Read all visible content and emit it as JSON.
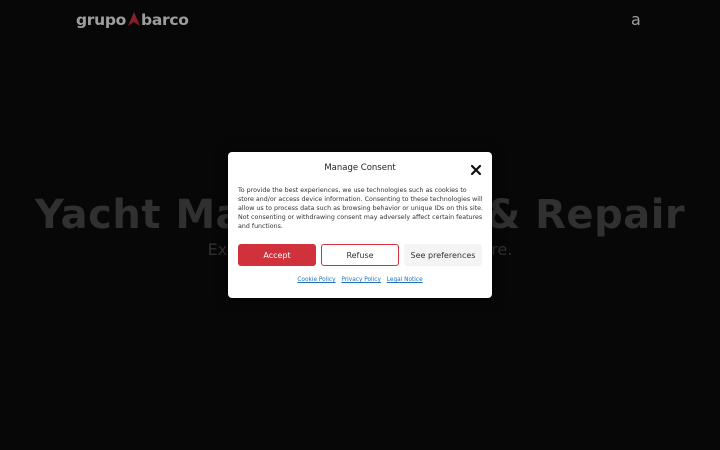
{
  "header": {
    "logo_left": "grupo",
    "logo_right": "barco",
    "menu_glyph": "a"
  },
  "hero": {
    "title": "Yacht Maintenance & Repair",
    "subtitle": "Experienced professionals. Anywhere."
  },
  "consent": {
    "title": "Manage Consent",
    "body": "To provide the best experiences, we use technologies such as cookies to store and/or access device information. Consenting to these technologies will allow us to process data such as browsing behavior or unique IDs on this site. Not consenting or withdrawing consent may adversely affect certain features and functions.",
    "accept_label": "Accept",
    "refuse_label": "Refuse",
    "prefs_label": "See preferences",
    "links": [
      "Cookie Policy",
      "Privacy Policy",
      "Legal Notice"
    ]
  },
  "colors": {
    "accent": "#d0313b",
    "background": "#0b0b0b",
    "link": "#1e73be"
  }
}
